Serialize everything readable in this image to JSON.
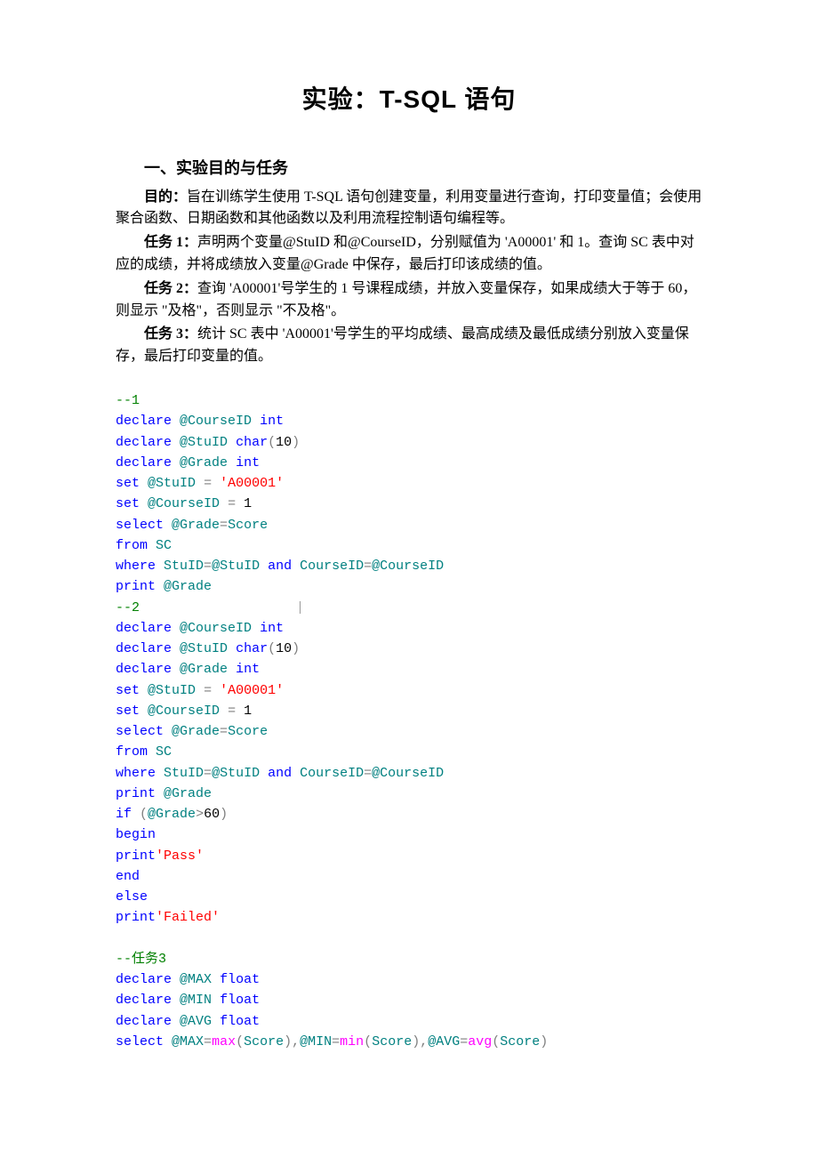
{
  "title": "实验：T-SQL 语句",
  "section_heading": "一、实验目的与任务",
  "purpose_label": "目的：",
  "purpose_text": "旨在训练学生使用 T-SQL 语句创建变量，利用变量进行查询，打印变量值；会使用聚合函数、日期函数和其他函数以及利用流程控制语句编程等。",
  "task1_label": "任务 1：",
  "task1_text": "声明两个变量@StuID 和@CourseID，分别赋值为 'A00001' 和 1。查询 SC 表中对应的成绩，并将成绩放入变量@Grade 中保存，最后打印该成绩的值。",
  "task2_label": "任务 2：",
  "task2_text": "查询 'A00001'号学生的 1 号课程成绩，并放入变量保存，如果成绩大于等于 60，则显示 \"及格\"，否则显示 \"不及格\"。",
  "task3_label": "任务 3：",
  "task3_text": "统计 SC 表中 'A00001'号学生的平均成绩、最高成绩及最低成绩分别放入变量保存，最后打印变量的值。",
  "code": {
    "c1_comment": "--1",
    "c1_l1_a": "declare",
    "c1_l1_b": "@CourseID",
    "c1_l1_c": "int",
    "c1_l2_a": "declare",
    "c1_l2_b": "@StuID",
    "c1_l2_c": "char",
    "c1_l2_d": "(",
    "c1_l2_e": "10",
    "c1_l2_f": ")",
    "c1_l3_a": "declare",
    "c1_l3_b": "@Grade",
    "c1_l3_c": "int",
    "c1_l4_a": "set",
    "c1_l4_b": "@StuID",
    "c1_l4_c": "=",
    "c1_l4_d": "'A00001'",
    "c1_l5_a": "set",
    "c1_l5_b": "@CourseID",
    "c1_l5_c": "=",
    "c1_l5_d": "1",
    "c1_l6_a": "select",
    "c1_l6_b": "@Grade",
    "c1_l6_c": "=",
    "c1_l6_d": "Score",
    "c1_l7_a": "from",
    "c1_l7_b": "SC",
    "c1_l8_a": "where",
    "c1_l8_b": "StuID",
    "c1_l8_c": "=",
    "c1_l8_d": "@StuID",
    "c1_l8_e": "and",
    "c1_l8_f": "CourseID",
    "c1_l8_g": "=",
    "c1_l8_h": "@CourseID",
    "c1_l9_a": "print",
    "c1_l9_b": "@Grade",
    "c2_comment": "--2",
    "c2_l1_a": "declare",
    "c2_l1_b": "@CourseID",
    "c2_l1_c": "int",
    "c2_l2_a": "declare",
    "c2_l2_b": "@StuID",
    "c2_l2_c": "char",
    "c2_l2_d": "(",
    "c2_l2_e": "10",
    "c2_l2_f": ")",
    "c2_l3_a": "declare",
    "c2_l3_b": "@Grade",
    "c2_l3_c": "int",
    "c2_l4_a": "set",
    "c2_l4_b": "@StuID",
    "c2_l4_c": "=",
    "c2_l4_d": "'A00001'",
    "c2_l5_a": "set",
    "c2_l5_b": "@CourseID",
    "c2_l5_c": "=",
    "c2_l5_d": "1",
    "c2_l6_a": "select",
    "c2_l6_b": "@Grade",
    "c2_l6_c": "=",
    "c2_l6_d": "Score",
    "c2_l7_a": "from",
    "c2_l7_b": "SC",
    "c2_l8_a": "where",
    "c2_l8_b": "StuID",
    "c2_l8_c": "=",
    "c2_l8_d": "@StuID",
    "c2_l8_e": "and",
    "c2_l8_f": "CourseID",
    "c2_l8_g": "=",
    "c2_l8_h": "@CourseID",
    "c2_l9_a": "print",
    "c2_l9_b": "@Grade",
    "c2_l10_a": "if",
    "c2_l10_b": "(",
    "c2_l10_c": "@Grade",
    "c2_l10_d": ">",
    "c2_l10_e": "60",
    "c2_l10_f": ")",
    "c2_l11_a": "begin",
    "c2_l12_a": "print",
    "c2_l12_b": "'Pass'",
    "c2_l13_a": "end",
    "c2_l14_a": "else",
    "c2_l15_a": "print",
    "c2_l15_b": "'Failed'",
    "c3_comment": "--任务3",
    "c3_l1_a": "declare",
    "c3_l1_b": "@MAX",
    "c3_l1_c": "float",
    "c3_l2_a": "declare",
    "c3_l2_b": "@MIN",
    "c3_l2_c": "float",
    "c3_l3_a": "declare",
    "c3_l3_b": "@AVG",
    "c3_l3_c": "float",
    "c3_l4_a": "select",
    "c3_l4_b": "@MAX",
    "c3_l4_c": "=",
    "c3_l4_d": "max",
    "c3_l4_e": "(",
    "c3_l4_f": "Score",
    "c3_l4_g": "),",
    "c3_l4_h": "@MIN",
    "c3_l4_i": "=",
    "c3_l4_j": "min",
    "c3_l4_k": "(",
    "c3_l4_l": "Score",
    "c3_l4_m": "),",
    "c3_l4_n": "@AVG",
    "c3_l4_o": "=",
    "c3_l4_p": "avg",
    "c3_l4_q": "(",
    "c3_l4_r": "Score",
    "c3_l4_s": ")"
  }
}
